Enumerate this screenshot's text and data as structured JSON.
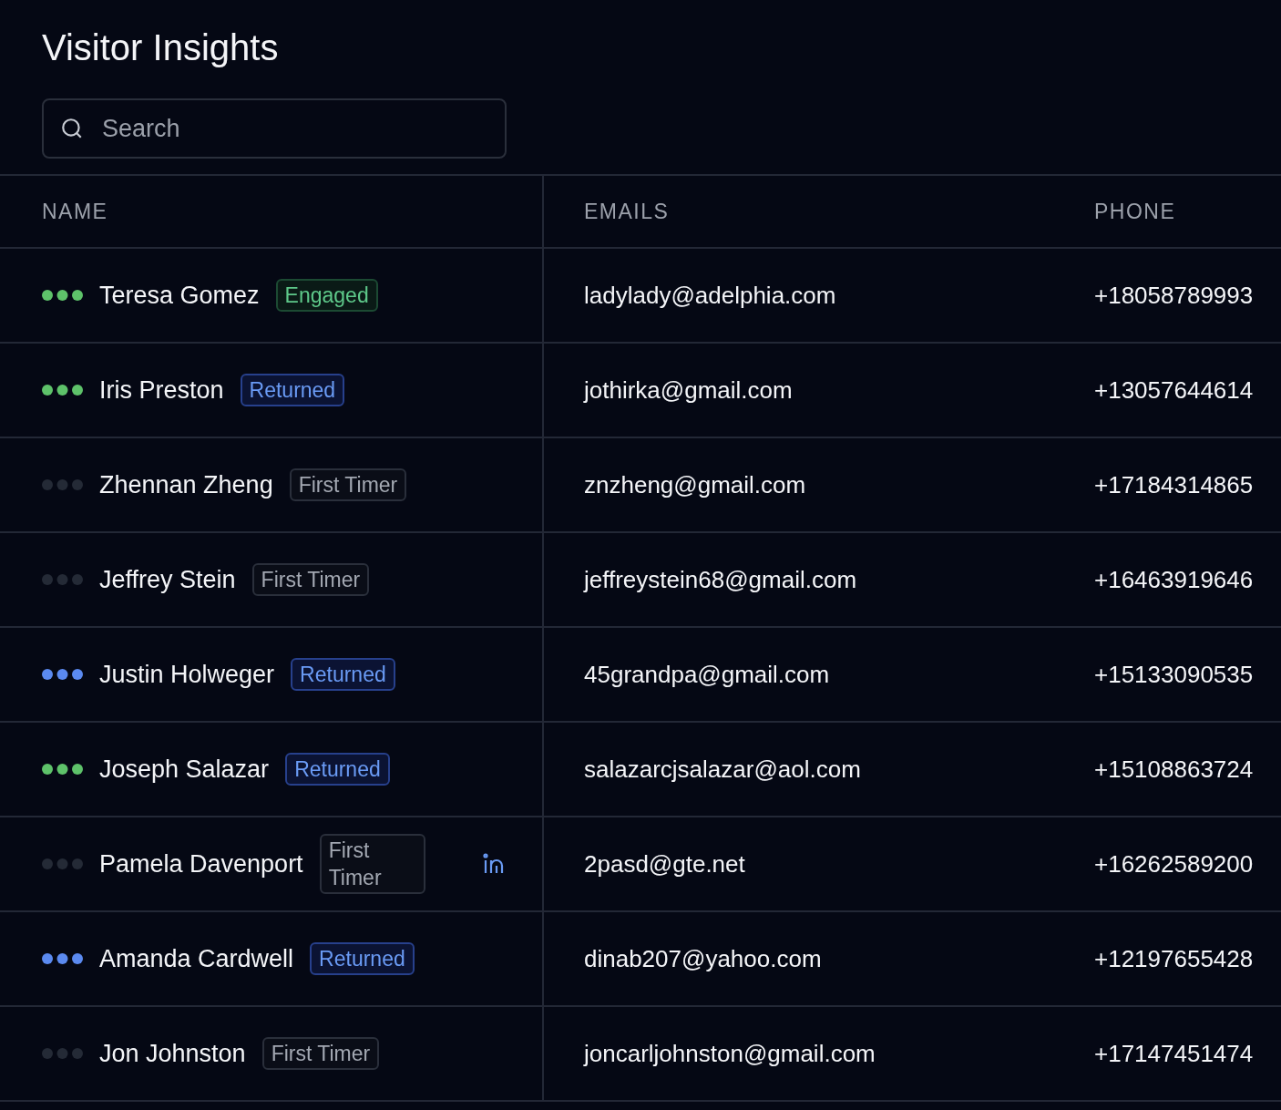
{
  "title": "Visitor Insights",
  "search": {
    "placeholder": "Search"
  },
  "columns": [
    "NAME",
    "EMAILS",
    "PHONE"
  ],
  "rows": [
    {
      "name": "Teresa Gomez",
      "badge": {
        "kind": "engaged",
        "label": "Engaged"
      },
      "color": "#5ec26a",
      "email": "ladylady@adelphia.com",
      "phone": "+18058789993",
      "linkedin": false
    },
    {
      "name": "Iris Preston",
      "badge": {
        "kind": "returned",
        "label": "Returned"
      },
      "color": "#5ec26a",
      "email": "jothirka@gmail.com",
      "phone": "+13057644614",
      "linkedin": false
    },
    {
      "name": "Zhennan Zheng",
      "badge": {
        "kind": "first",
        "label": "First Timer"
      },
      "color": "#242a36",
      "email": "znzheng@gmail.com",
      "phone": "+17184314865",
      "linkedin": false
    },
    {
      "name": "Jeffrey Stein",
      "badge": {
        "kind": "first",
        "label": "First Timer"
      },
      "color": "#242a36",
      "email": "jeffreystein68@gmail.com",
      "phone": "+16463919646",
      "linkedin": false
    },
    {
      "name": "Justin Holweger",
      "badge": {
        "kind": "returned",
        "label": "Returned"
      },
      "color": "#5b8af0",
      "email": "45grandpa@gmail.com",
      "phone": "+15133090535",
      "linkedin": false
    },
    {
      "name": "Joseph Salazar",
      "badge": {
        "kind": "returned",
        "label": "Returned"
      },
      "color": "#5ec26a",
      "email": "salazarcjsalazar@aol.com",
      "phone": "+15108863724",
      "linkedin": false
    },
    {
      "name": "Pamela Davenport",
      "badge": {
        "kind": "first",
        "label": "First Timer"
      },
      "color": "#242a36",
      "email": "2pasd@gte.net",
      "phone": "+16262589200",
      "linkedin": true
    },
    {
      "name": "Amanda Cardwell",
      "badge": {
        "kind": "returned",
        "label": "Returned"
      },
      "color": "#5b8af0",
      "email": "dinab207@yahoo.com",
      "phone": "+12197655428",
      "linkedin": false
    },
    {
      "name": "Jon Johnston",
      "badge": {
        "kind": "first",
        "label": "First Timer"
      },
      "color": "#242a36",
      "email": "joncarljohnston@gmail.com",
      "phone": "+17147451474",
      "linkedin": false
    }
  ]
}
